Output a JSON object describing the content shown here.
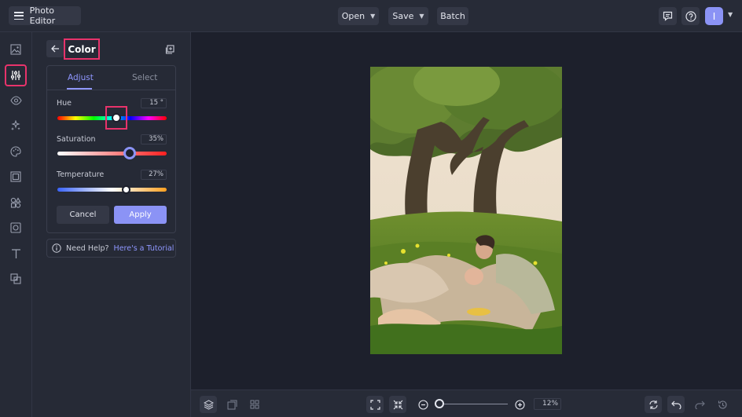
{
  "app": {
    "title": "Photo Editor"
  },
  "toolbar": {
    "open_label": "Open",
    "save_label": "Save",
    "batch_label": "Batch",
    "avatar_initial": "I"
  },
  "panel": {
    "title": "Color",
    "tabs": [
      {
        "label": "Adjust",
        "active": true
      },
      {
        "label": "Select",
        "active": false
      }
    ],
    "sliders": {
      "hue": {
        "label": "Hue",
        "value": "15",
        "unit": "°",
        "fraction": 0.54
      },
      "saturation": {
        "label": "Saturation",
        "value": "35",
        "unit": "%",
        "fraction": 0.66
      },
      "temperature": {
        "label": "Temperature",
        "value": "27",
        "unit": "%",
        "fraction": 0.63
      }
    },
    "cancel_label": "Cancel",
    "apply_label": "Apply",
    "help_text": "Need Help?",
    "help_link": "Here's a Tutorial"
  },
  "bottom": {
    "zoom": "12",
    "zoom_unit": "%",
    "zoom_fraction": 0.0
  },
  "colors": {
    "accent": "#8b93f5",
    "highlight": "#e8336b",
    "background": "#1d202c"
  },
  "icons": {
    "rail": [
      "image-icon",
      "sliders-icon",
      "eye-icon",
      "sparkle-icon",
      "palette-icon",
      "frame-icon",
      "shapes-icon",
      "texture-icon",
      "text-icon",
      "overlay-icon"
    ],
    "top_right": [
      "comment-icon",
      "help-icon"
    ],
    "bottom_left": [
      "layers-icon",
      "replace-image-icon",
      "grid-icon"
    ],
    "bottom_right": [
      "sync-icon",
      "undo-icon",
      "redo-icon",
      "history-icon"
    ]
  }
}
